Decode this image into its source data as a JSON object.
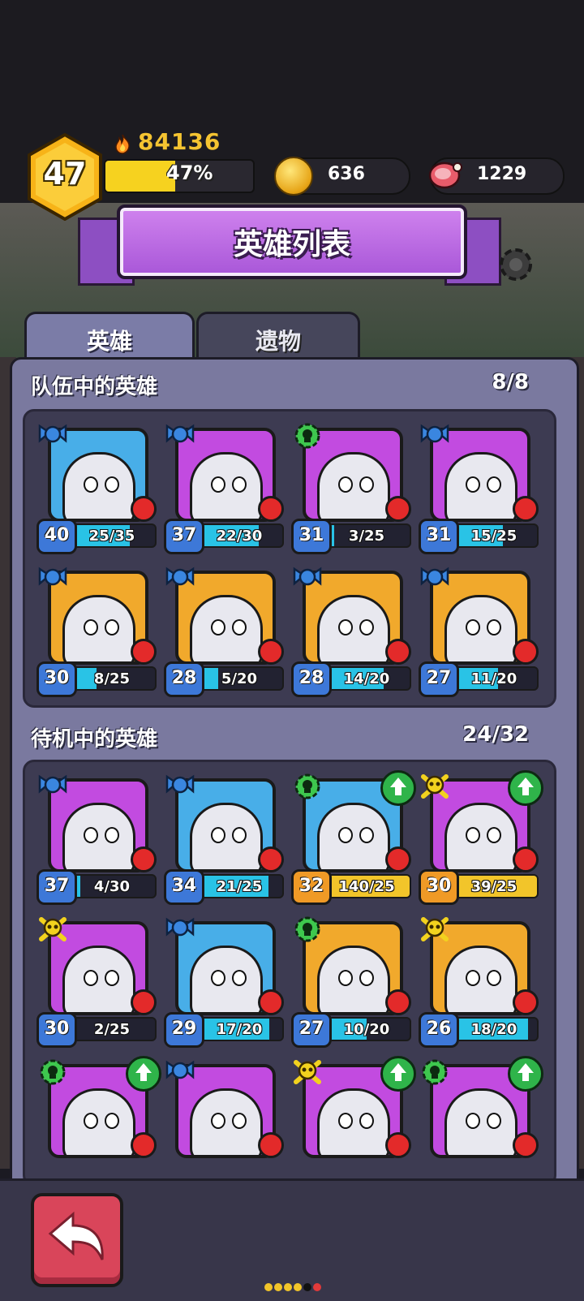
{
  "player": {
    "level": "47",
    "power": "84136",
    "xp_percent": "47%",
    "xp_fraction": 0.47
  },
  "resources": {
    "coins": "636",
    "meat": "1229"
  },
  "title": "英雄列表",
  "tabs": [
    {
      "label": "英雄",
      "active": true
    },
    {
      "label": "遗物",
      "active": false
    }
  ],
  "team": {
    "title": "队伍中的英雄",
    "count": "8/8",
    "heroes": [
      {
        "level": "40",
        "shards": "25/35",
        "fill": 0.71,
        "class": "wing",
        "color": "#48aee8"
      },
      {
        "level": "37",
        "shards": "22/30",
        "fill": 0.73,
        "class": "wing",
        "color": "#c24be0"
      },
      {
        "level": "31",
        "shards": "3/25",
        "fill": 0.12,
        "class": "gear",
        "color": "#c24be0"
      },
      {
        "level": "31",
        "shards": "15/25",
        "fill": 0.6,
        "class": "wing",
        "color": "#c24be0"
      },
      {
        "level": "30",
        "shards": "8/25",
        "fill": 0.32,
        "class": "wing",
        "color": "#f1a92c"
      },
      {
        "level": "28",
        "shards": "5/20",
        "fill": 0.25,
        "class": "wing",
        "color": "#f1a92c"
      },
      {
        "level": "28",
        "shards": "14/20",
        "fill": 0.7,
        "class": "wing",
        "color": "#f1a92c"
      },
      {
        "level": "27",
        "shards": "11/20",
        "fill": 0.55,
        "class": "wing",
        "color": "#f1a92c"
      }
    ]
  },
  "reserve": {
    "title": "待机中的英雄",
    "count": "24/32",
    "heroes": [
      {
        "level": "37",
        "shards": "4/30",
        "fill": 0.13,
        "class": "wing",
        "color": "#c24be0"
      },
      {
        "level": "34",
        "shards": "21/25",
        "fill": 0.84,
        "class": "wing",
        "color": "#48aee8"
      },
      {
        "level": "32",
        "shards": "140/25",
        "fill": 1.0,
        "class": "gear",
        "color": "#48aee8",
        "upgrade": true
      },
      {
        "level": "30",
        "shards": "39/25",
        "fill": 1.0,
        "class": "skull",
        "color": "#c24be0",
        "upgrade": true
      },
      {
        "level": "30",
        "shards": "2/25",
        "fill": 0.08,
        "class": "skull",
        "color": "#c24be0"
      },
      {
        "level": "29",
        "shards": "17/20",
        "fill": 0.85,
        "class": "wing",
        "color": "#48aee8"
      },
      {
        "level": "27",
        "shards": "10/20",
        "fill": 0.5,
        "class": "gear",
        "color": "#f1a92c"
      },
      {
        "level": "26",
        "shards": "18/20",
        "fill": 0.9,
        "class": "skull",
        "color": "#f1a92c"
      },
      {
        "level": "",
        "shards": "",
        "fill": 0,
        "class": "gear",
        "color": "#c24be0",
        "upgrade": true
      },
      {
        "level": "",
        "shards": "",
        "fill": 0,
        "class": "wing",
        "color": "#c24be0"
      },
      {
        "level": "",
        "shards": "",
        "fill": 0,
        "class": "skull",
        "color": "#c24be0",
        "upgrade": true
      },
      {
        "level": "",
        "shards": "",
        "fill": 0,
        "class": "gear",
        "color": "#c24be0",
        "upgrade": true
      }
    ]
  },
  "colors": {
    "rarity_blue": "#48aee8",
    "rarity_purple": "#c24be0",
    "rarity_gold": "#f1a92c",
    "bar_blue": "#29c3e6",
    "bar_gold": "#f2c52a"
  },
  "pager_dots": [
    "#f2c52a",
    "#f2c52a",
    "#f2c52a",
    "#f2c52a",
    "#111111",
    "#e23a3a"
  ]
}
